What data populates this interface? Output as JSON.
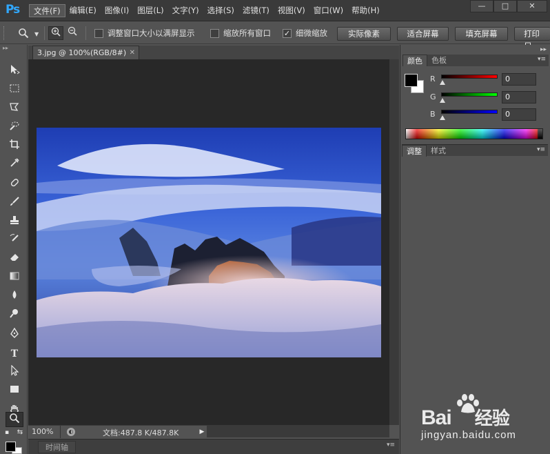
{
  "app": {
    "logo": "Ps",
    "menu": [
      "文件(F)",
      "编辑(E)",
      "图像(I)",
      "图层(L)",
      "文字(Y)",
      "选择(S)",
      "滤镜(T)",
      "视图(V)",
      "窗口(W)",
      "帮助(H)"
    ],
    "active_menu_index": 0,
    "window_controls": {
      "minimize": "—",
      "maximize": "□",
      "close": "✕"
    }
  },
  "options": {
    "resize_windows_label": "调整窗口大小以满屏显示",
    "resize_windows_checked": false,
    "zoom_all_label": "缩放所有窗口",
    "zoom_all_checked": false,
    "scrubby_zoom_label": "细微缩放",
    "scrubby_zoom_checked": true,
    "actual_pixels_label": "实际像素",
    "fit_screen_label": "适合屏幕",
    "fill_screen_label": "填充屏幕",
    "print_size_label": "打印尺"
  },
  "document": {
    "tab_title": "3.jpg @ 100%(RGB/8#)",
    "tab_close": "✕",
    "zoom": "100%",
    "doc_info": "文档:487.8 K/487.8K"
  },
  "timeline": {
    "label": "时间轴"
  },
  "color_panel": {
    "tabs": [
      "颜色",
      "色板"
    ],
    "active_tab": 0,
    "channels": [
      {
        "label": "R",
        "value": "0",
        "color": "#ff0000"
      },
      {
        "label": "G",
        "value": "0",
        "color": "#00ff00"
      },
      {
        "label": "B",
        "value": "0",
        "color": "#0000ff"
      }
    ],
    "foreground": "#000000",
    "background": "#ffffff"
  },
  "adjust_panel": {
    "tabs": [
      "调整",
      "样式"
    ],
    "active_tab": 0
  },
  "watermark": {
    "logo_text": "Bai",
    "logo_text_2": "经验",
    "url": "jingyan.baidu.com"
  }
}
